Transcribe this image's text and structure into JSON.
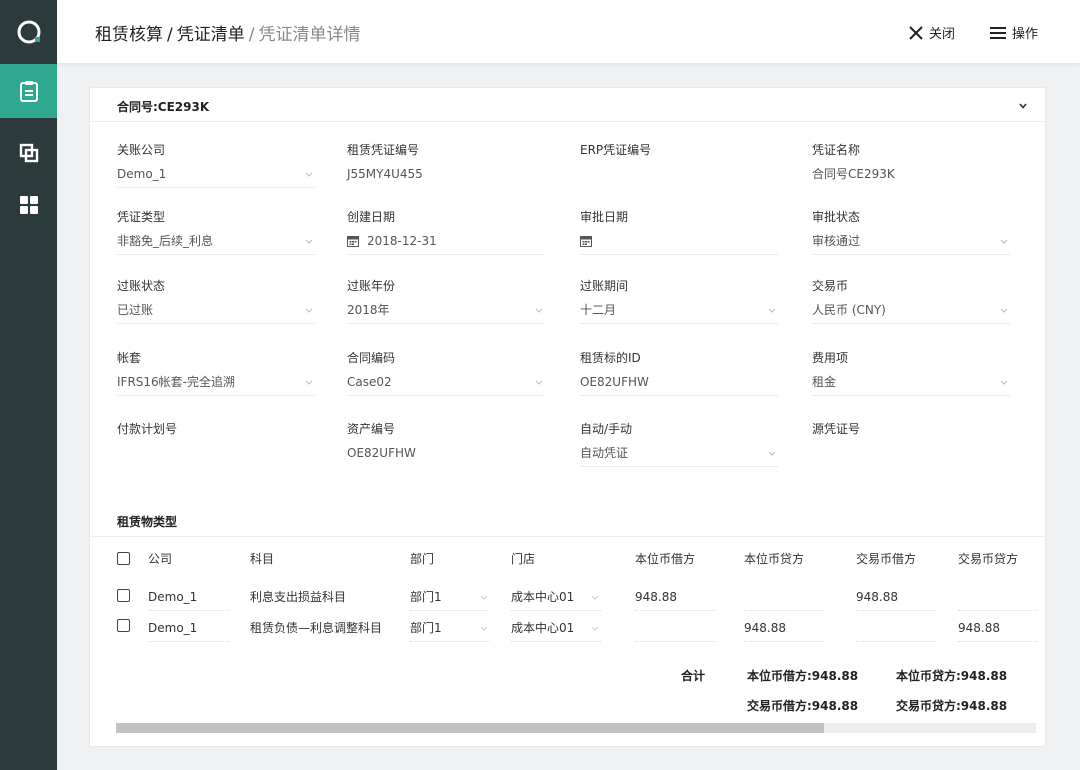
{
  "breadcrumb": {
    "part1": "租赁核算",
    "sep1": "/",
    "part2": "凭证清单",
    "sep2": "/",
    "current": "凭证清单详情"
  },
  "toolbar": {
    "close_label": "关闭",
    "actions_label": "操作"
  },
  "sidebar": {
    "items": [
      "logo-icon",
      "clipboard-icon",
      "copy-icon",
      "grid-icon"
    ],
    "active_color": "#2ea88f"
  },
  "header": {
    "contract": "合同号:CE293K"
  },
  "fields": {
    "company": {
      "label": "关账公司",
      "value": "Demo_1"
    },
    "lease_voucher_no": {
      "label": "租赁凭证编号",
      "value": "J55MY4U455"
    },
    "erp_voucher_no": {
      "label": "ERP凭证编号",
      "value": ""
    },
    "voucher_name": {
      "label": "凭证名称",
      "value": "合同号CE293K"
    },
    "voucher_type": {
      "label": "凭证类型",
      "value": "非豁免_后续_利息"
    },
    "created_date": {
      "label": "创建日期",
      "value": "2018-12-31"
    },
    "approval_date": {
      "label": "审批日期",
      "value": ""
    },
    "approval_status": {
      "label": "审批状态",
      "value": "审核通过"
    },
    "posting_status": {
      "label": "过账状态",
      "value": "已过账"
    },
    "posting_year": {
      "label": "过账年份",
      "value": "2018年"
    },
    "posting_period": {
      "label": "过账期间",
      "value": "十二月"
    },
    "currency": {
      "label": "交易币",
      "value": "人民币 (CNY)"
    },
    "ledger": {
      "label": "帐套",
      "value": "IFRS16帐套-完全追溯"
    },
    "contract_code": {
      "label": "合同编码",
      "value": "Case02"
    },
    "lease_asset_id": {
      "label": "租赁标的ID",
      "value": "OE82UFHW"
    },
    "expense_item": {
      "label": "费用项",
      "value": "租金"
    },
    "payment_plan_no": {
      "label": "付款计划号",
      "value": ""
    },
    "asset_no": {
      "label": "资产编号",
      "value": "OE82UFHW"
    },
    "auto_manual": {
      "label": "自动/手动",
      "value": "自动凭证"
    },
    "source_voucher_no": {
      "label": "源凭证号",
      "value": ""
    }
  },
  "table": {
    "section_title": "租赁物类型",
    "columns": [
      "公司",
      "科目",
      "部门",
      "门店",
      "本位币借方",
      "本位币贷方",
      "交易币借方",
      "交易币贷方"
    ],
    "rows": [
      [
        "Demo_1",
        "利息支出损益科目",
        "部门1",
        "成本中心01",
        "948.88",
        "",
        "948.88",
        ""
      ],
      [
        "Demo_1",
        "租赁负债—利息调整科目",
        "部门1",
        "成本中心01",
        "",
        "948.88",
        "",
        "948.88"
      ]
    ],
    "totals": {
      "label": "合计",
      "local_debit": "本位币借方:948.88",
      "local_credit": "本位币贷方:948.88",
      "trade_debit": "交易币借方:948.88",
      "trade_credit": "交易币贷方:948.88"
    }
  },
  "scroll_position": 0.77
}
